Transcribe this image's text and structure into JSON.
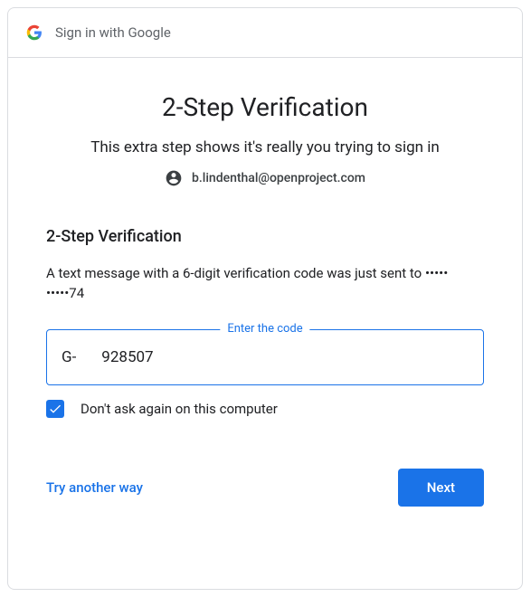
{
  "header": {
    "title": "Sign in with Google"
  },
  "main": {
    "title": "2-Step Verification",
    "subtitle": "This extra step shows it's really you trying to sign in",
    "email": "b.lindenthal@openproject.com"
  },
  "verification": {
    "section_title": "2-Step Verification",
    "message": "A text message with a 6-digit verification code was just sent to ••••• •••••74",
    "input_label": "Enter the code",
    "prefix": "G-",
    "code_value": "928507",
    "checkbox_label": "Don't ask again on this computer",
    "checkbox_checked": true
  },
  "actions": {
    "alt_link": "Try another way",
    "next_label": "Next"
  },
  "colors": {
    "accent": "#1a73e8",
    "border": "#dadce0",
    "text_primary": "#202124",
    "text_secondary": "#5f6368"
  }
}
